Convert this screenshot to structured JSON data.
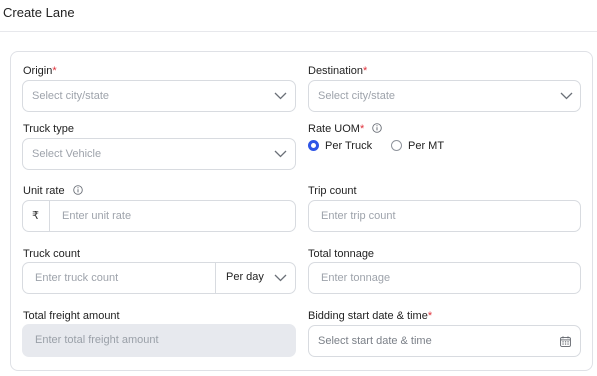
{
  "page": {
    "title": "Create Lane"
  },
  "form": {
    "origin": {
      "label": "Origin",
      "required_mark": "*",
      "placeholder": "Select city/state"
    },
    "destination": {
      "label": "Destination",
      "required_mark": "*",
      "placeholder": "Select city/state"
    },
    "truck_type": {
      "label": "Truck type",
      "placeholder": "Select Vehicle"
    },
    "rate_uom": {
      "label": "Rate UOM",
      "required_mark": "*",
      "options": [
        {
          "label": "Per Truck",
          "selected": true
        },
        {
          "label": "Per MT",
          "selected": false
        }
      ]
    },
    "unit_rate": {
      "label": "Unit rate",
      "currency_symbol": "₹",
      "placeholder": "Enter unit rate"
    },
    "trip_count": {
      "label": "Trip count",
      "placeholder": "Enter trip count"
    },
    "truck_count": {
      "label": "Truck count",
      "placeholder": "Enter truck count",
      "unit_selected": "Per day"
    },
    "total_tonnage": {
      "label": "Total tonnage",
      "placeholder": "Enter tonnage"
    },
    "total_freight": {
      "label": "Total freight amount",
      "placeholder": "Enter total freight amount"
    },
    "bidding_start": {
      "label": "Bidding start date & time",
      "required_mark": "*",
      "placeholder": "Select start date & time"
    }
  },
  "icons": {
    "dropdown": "chevron-down-icon",
    "info": "info-icon",
    "calendar": "calendar-icon"
  },
  "colors": {
    "accent": "#2e55e6",
    "required": "#e0313a",
    "disabled_bg": "#e7e9ee",
    "border": "#d8dbe0"
  }
}
